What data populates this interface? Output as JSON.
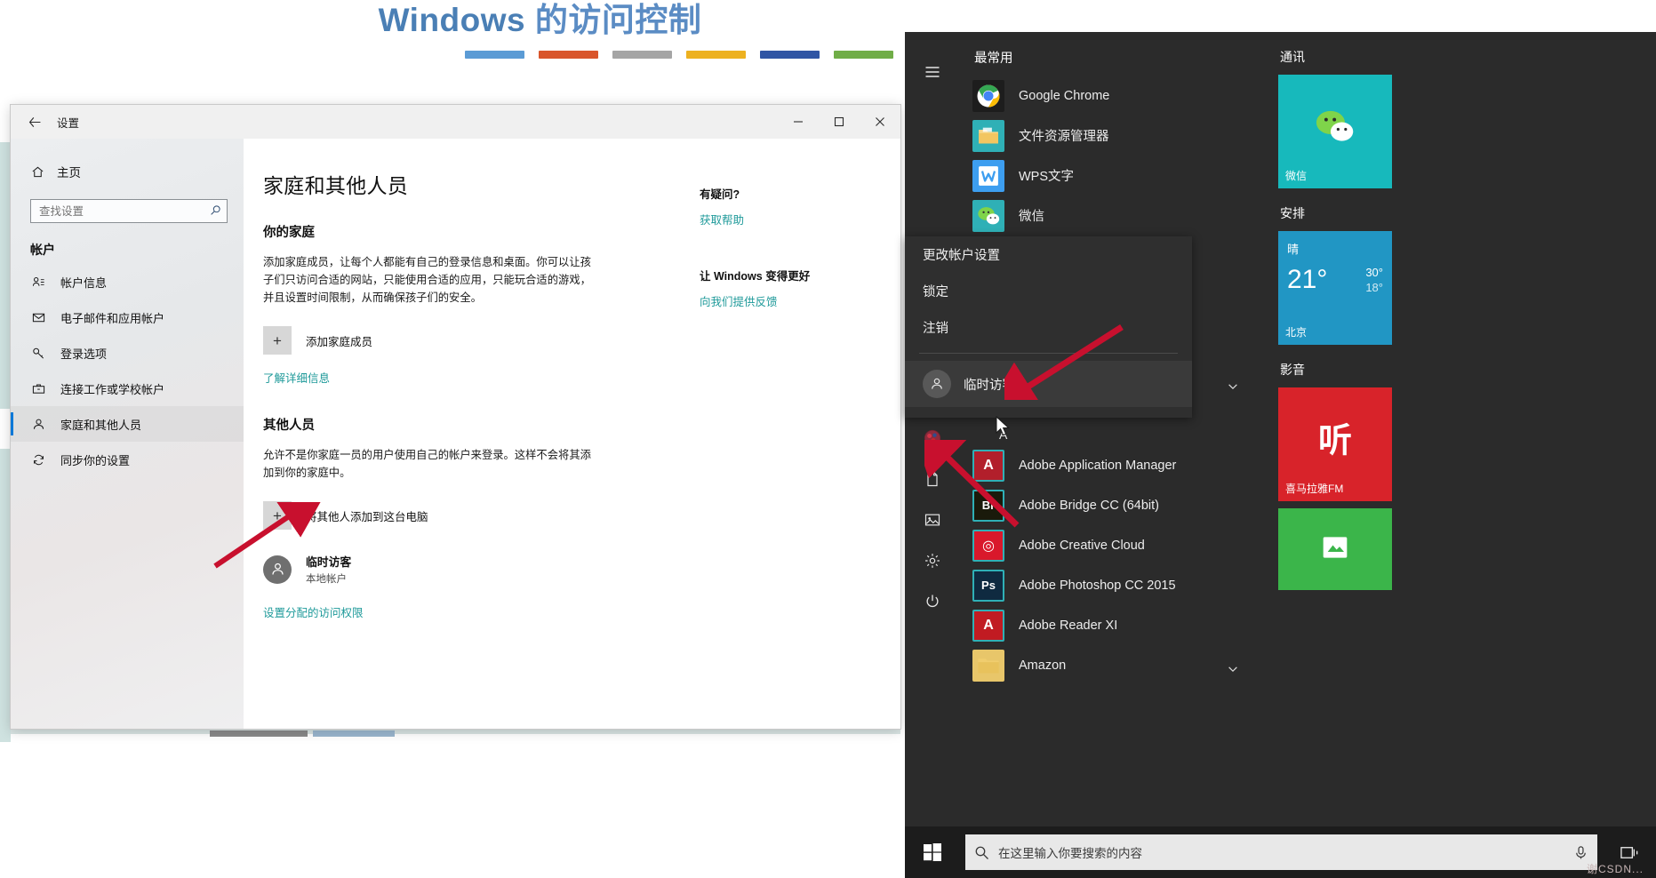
{
  "banner": {
    "title_en": "Windows",
    "title_zh": " 的访问控制",
    "bars": [
      {
        "name": "bar-blue",
        "color": "#5b9bd5"
      },
      {
        "name": "bar-orange",
        "color": "#d9552b"
      },
      {
        "name": "bar-gray",
        "color": "#a5a5a5"
      },
      {
        "name": "bar-yellow",
        "color": "#edb120"
      },
      {
        "name": "bar-navy",
        "color": "#2f55a4"
      },
      {
        "name": "bar-green",
        "color": "#70ad47"
      }
    ]
  },
  "settings": {
    "titlebar": {
      "back": "←",
      "title": "设置",
      "minimize": "─",
      "maximize": "□",
      "close": "✕"
    },
    "nav": {
      "home": "主页",
      "search_placeholder": "查找设置",
      "section": "帐户",
      "items": [
        {
          "label": "帐户信息",
          "icon": "account-info-icon",
          "selected": false
        },
        {
          "label": "电子邮件和应用帐户",
          "icon": "mail-icon",
          "selected": false
        },
        {
          "label": "登录选项",
          "icon": "key-icon",
          "selected": false
        },
        {
          "label": "连接工作或学校帐户",
          "icon": "briefcase-icon",
          "selected": false
        },
        {
          "label": "家庭和其他人员",
          "icon": "person-icon",
          "selected": true
        },
        {
          "label": "同步你的设置",
          "icon": "sync-icon",
          "selected": false
        }
      ]
    },
    "page_title": "家庭和其他人员",
    "family": {
      "heading": "你的家庭",
      "paragraph": "添加家庭成员，让每个人都能有自己的登录信息和桌面。你可以让孩子们只访问合适的网站，只能使用合适的应用，只能玩合适的游戏，并且设置时间限制，从而确保孩子们的安全。",
      "add_member": "添加家庭成员",
      "learn_more": "了解详细信息"
    },
    "others": {
      "heading": "其他人员",
      "paragraph": "允许不是你家庭一员的用户使用自己的帐户来登录。这样不会将其添加到你的家庭中。",
      "add_other": "将其他人添加到这台电脑",
      "user_name": "临时访客",
      "user_type": "本地帐户",
      "assigned_access": "设置分配的访问权限"
    },
    "help": {
      "question": "有疑问?",
      "get_help": "获取帮助",
      "improve": "让 Windows 变得更好",
      "feedback": "向我们提供反馈"
    }
  },
  "startmenu": {
    "rail": [
      {
        "name": "hamburger-icon",
        "label": "展开"
      },
      {
        "name": "user-account-icon",
        "label": "帐户"
      },
      {
        "name": "documents-icon",
        "label": "文档"
      },
      {
        "name": "pictures-icon",
        "label": "图片"
      },
      {
        "name": "settings-gear-icon",
        "label": "设置"
      },
      {
        "name": "power-icon",
        "label": "电源"
      }
    ],
    "most_used_title": "最常用",
    "most_used": [
      {
        "label": "Google Chrome",
        "icon": "chrome-icon",
        "bg": "#1d1d1d"
      },
      {
        "label": "文件资源管理器",
        "icon": "file-explorer-icon",
        "bg": "#2fb0b6"
      },
      {
        "label": "WPS文字",
        "icon": "wps-writer-icon",
        "bg": "#3d9ef0"
      },
      {
        "label": "微信",
        "icon": "wechat-icon",
        "bg": "#2fb0b6"
      }
    ],
    "alpha_heading": "A",
    "apps": [
      {
        "label": "Adobe Application Manager",
        "icon": "adobe-am-icon",
        "bg": "#b21f2b",
        "glyph": "A"
      },
      {
        "label": "Adobe Bridge CC (64bit)",
        "icon": "adobe-bridge-icon",
        "bg": "#1a1a0b",
        "glyph": "Br"
      },
      {
        "label": "Adobe Creative Cloud",
        "icon": "adobe-cc-icon",
        "bg": "#d9182b",
        "glyph": "◎"
      },
      {
        "label": "Adobe Photoshop CC 2015",
        "icon": "adobe-ps-icon",
        "bg": "#0f2a40",
        "glyph": "Ps"
      },
      {
        "label": "Adobe Reader XI",
        "icon": "adobe-reader-icon",
        "bg": "#c11b22",
        "glyph": "A"
      },
      {
        "label": "Amazon",
        "icon": "amazon-folder-icon",
        "bg": "#e8c66a",
        "glyph": ""
      }
    ],
    "tile_groups": [
      {
        "title": "通讯",
        "tiles": [
          {
            "label": "微信",
            "icon": "wechat-tile-icon",
            "bg": "#17b9bc"
          }
        ]
      },
      {
        "title": "安排",
        "tiles": [
          {
            "label": "北京",
            "icon": "weather-tile-icon",
            "bg": "#2196c4",
            "condition": "晴",
            "temp": "21°",
            "high": "30°",
            "low": "18°"
          }
        ]
      },
      {
        "title": "影音",
        "tiles": [
          {
            "label": "喜马拉雅FM",
            "icon": "ximalaya-tile-icon",
            "bg": "#d8232a",
            "glyph": "听"
          },
          {
            "label": "",
            "icon": "green-tile-icon",
            "bg": "#3bb54a",
            "glyph": ""
          }
        ]
      }
    ],
    "context_menu": {
      "items": [
        "更改帐户设置",
        "锁定",
        "注销"
      ],
      "account": "临时访客"
    },
    "taskbar": {
      "start": "start-icon",
      "search_placeholder": "在这里输入你要搜索的内容",
      "mic": "microphone-icon",
      "taskview": "task-view-icon"
    }
  },
  "annotations": {
    "arrow_color": "#c8102e",
    "arrows": [
      {
        "name": "arrow-to-startmenu-guest"
      },
      {
        "name": "arrow-to-rail-account"
      },
      {
        "name": "arrow-to-settings-guest"
      }
    ]
  },
  "watermark": "谢CSDN..."
}
